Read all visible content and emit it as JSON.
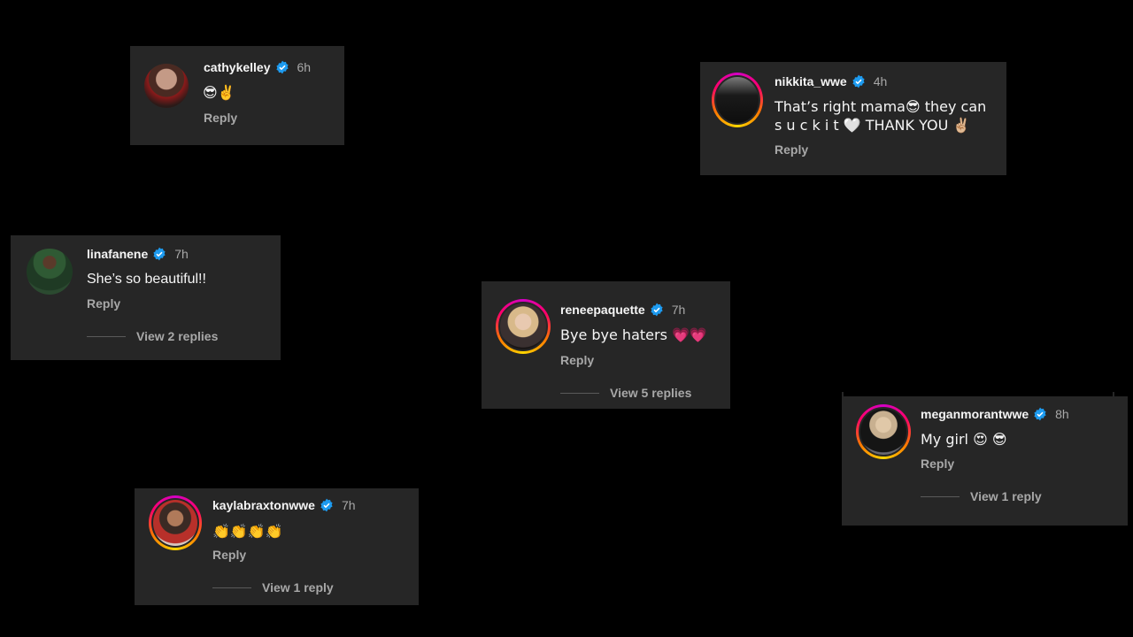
{
  "comments": [
    {
      "username": "cathykelley",
      "time": "6h",
      "text": "😎✌️",
      "reply": "Reply",
      "view_replies": ""
    },
    {
      "username": "nikkita_wwe",
      "time": "4h",
      "text": "That’s right mama😎 they can",
      "text2": "s u c k  i t 🤍 THANK YOU ✌🏼",
      "reply": "Reply",
      "view_replies": ""
    },
    {
      "username": "linafanene",
      "time": "7h",
      "text": "She’s so beautiful!!",
      "reply": "Reply",
      "view_replies": "View 2 replies"
    },
    {
      "username": "reneepaquette",
      "time": "7h",
      "text": "Bye bye haters 💗💗",
      "reply": "Reply",
      "view_replies": "View 5 replies"
    },
    {
      "username": "meganmorantwwe",
      "time": "8h",
      "text": "My girl 😍 😎",
      "reply": "Reply",
      "view_replies": "View 1 reply"
    },
    {
      "username": "kaylabraxtonwwe",
      "time": "7h",
      "text": "👏👏👏👏",
      "reply": "Reply",
      "view_replies": "View 1 reply"
    }
  ],
  "colors": {
    "background": "#000000",
    "card": "#262626",
    "verified": "#1d9bf0",
    "muted": "#a8a8a8"
  },
  "icons": {
    "verified": "verified-badge-icon"
  }
}
